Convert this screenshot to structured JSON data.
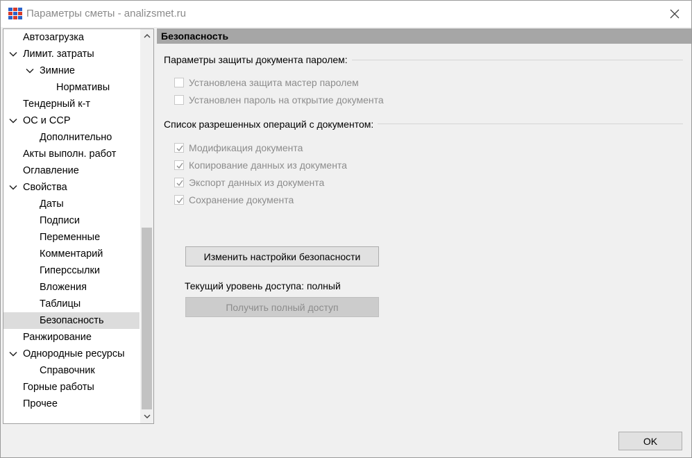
{
  "window": {
    "title": "Параметры сметы - analizsmet.ru"
  },
  "tree": {
    "items": [
      {
        "label": "Автозагрузка",
        "level": 0,
        "expandable": false,
        "selected": false
      },
      {
        "label": "Лимит. затраты",
        "level": 0,
        "expandable": true,
        "selected": false
      },
      {
        "label": "Зимние",
        "level": 1,
        "expandable": true,
        "selected": false
      },
      {
        "label": "Нормативы",
        "level": 2,
        "expandable": false,
        "selected": false
      },
      {
        "label": "Тендерный к-т",
        "level": 0,
        "expandable": false,
        "selected": false
      },
      {
        "label": "ОС и ССР",
        "level": 0,
        "expandable": true,
        "selected": false
      },
      {
        "label": "Дополнительно",
        "level": 1,
        "expandable": false,
        "selected": false
      },
      {
        "label": "Акты выполн. работ",
        "level": 0,
        "expandable": false,
        "selected": false
      },
      {
        "label": "Оглавление",
        "level": 0,
        "expandable": false,
        "selected": false
      },
      {
        "label": "Свойства",
        "level": 0,
        "expandable": true,
        "selected": false
      },
      {
        "label": "Даты",
        "level": 1,
        "expandable": false,
        "selected": false
      },
      {
        "label": "Подписи",
        "level": 1,
        "expandable": false,
        "selected": false
      },
      {
        "label": "Переменные",
        "level": 1,
        "expandable": false,
        "selected": false
      },
      {
        "label": "Комментарий",
        "level": 1,
        "expandable": false,
        "selected": false
      },
      {
        "label": "Гиперссылки",
        "level": 1,
        "expandable": false,
        "selected": false
      },
      {
        "label": "Вложения",
        "level": 1,
        "expandable": false,
        "selected": false
      },
      {
        "label": "Таблицы",
        "level": 1,
        "expandable": false,
        "selected": false
      },
      {
        "label": "Безопасность",
        "level": 1,
        "expandable": false,
        "selected": true
      },
      {
        "label": "Ранжирование",
        "level": 0,
        "expandable": false,
        "selected": false
      },
      {
        "label": "Однородные ресурсы",
        "level": 0,
        "expandable": true,
        "selected": false
      },
      {
        "label": "Справочник",
        "level": 1,
        "expandable": false,
        "selected": false
      },
      {
        "label": "Горные работы",
        "level": 0,
        "expandable": false,
        "selected": false
      },
      {
        "label": "Прочее",
        "level": 0,
        "expandable": false,
        "selected": false
      }
    ]
  },
  "content": {
    "header": "Безопасность",
    "password_group": {
      "title": "Параметры защиты документа паролем:",
      "options": [
        {
          "label": "Установлена защита мастер паролем",
          "checked": false
        },
        {
          "label": "Установлен пароль на открытие документа",
          "checked": false
        }
      ]
    },
    "operations_group": {
      "title": "Список разрешенных операций с документом:",
      "options": [
        {
          "label": "Модификация документа",
          "checked": true
        },
        {
          "label": "Копирование данных из документа",
          "checked": true
        },
        {
          "label": "Экспорт данных из документа",
          "checked": true
        },
        {
          "label": "Сохранение документа",
          "checked": true
        }
      ]
    },
    "change_button": "Изменить настройки безопасности",
    "access_level_text": "Текущий уровень доступа: полный",
    "full_access_button": "Получить полный доступ"
  },
  "footer": {
    "ok_label": "OK"
  },
  "colors": {
    "header_bg": "#a6a6a6",
    "selected_bg": "#dcdcdc",
    "window_bg": "#f0f0f0"
  }
}
